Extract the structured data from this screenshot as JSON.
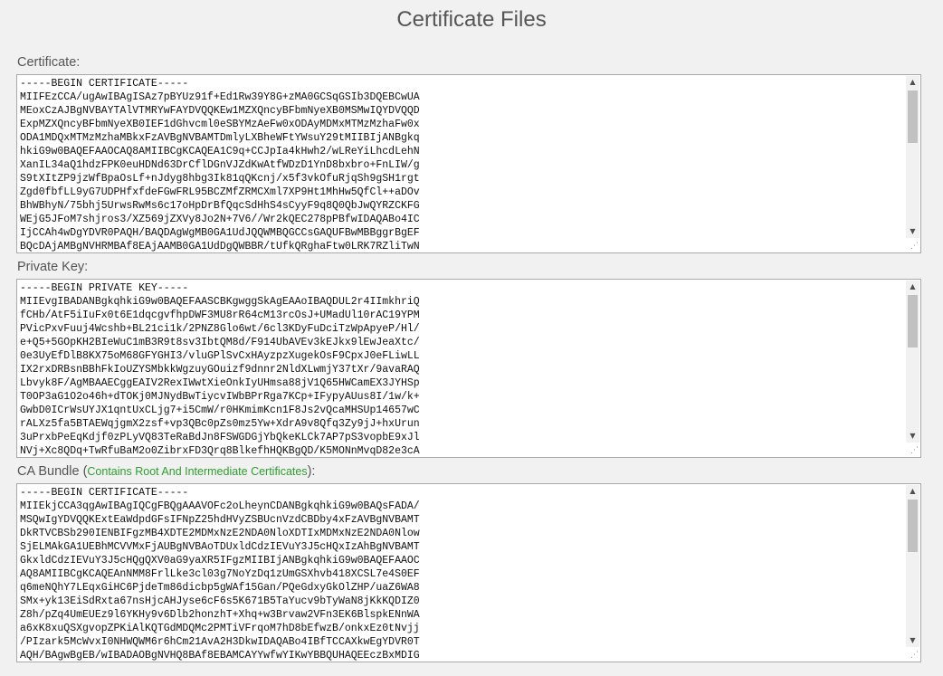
{
  "page": {
    "title": "Certificate Files"
  },
  "certificate": {
    "label": "Certificate:",
    "content": "-----BEGIN CERTIFICATE-----\nMIIFEzCCA/ugAwIBAgISAz7pBYUz91f+Ed1Rw39Y8G+zMA0GCSqGSIb3DQEBCwUA\nMEoxCzAJBgNVBAYTAlVTMRYwFAYDVQQKEw1MZXQncyBFbmNyeXB0MSMwIQYDVQQD\nExpMZXQncyBFbmNyeXB0IEF1dGhvcml0eSBYMzAeFw0xODAyMDMxMTMzMzhaFw0x\nODA1MDQxMTMzMzhaMBkxFzAVBgNVBAMTDmlyLXBheWFtYWsuY29tMIIBIjANBgkq\nhkiG9w0BAQEFAAOCAQ8AMIIBCgKCAQEA1C9q+CCJpIa4kHwh2/wLReYiLhcdLehN\nXanIL34aQ1hdzFPK0euHDNd63DrCflDGnVJZdKwAtfWDzD1YnD8bxbro+FnLIW/g\nS9tXItZP9jzWfBpaOsLf+nJdyg8hbg3Ik81qQKcnj/x5f3vkOfuRjqSh9gSH1rgt\nZgd0fbfLL9yG7UDPHfxfdeFGwFRL95BCZMfZRMCXml7XP9Ht1MhHw5QfCl++aDOv\nBhWBhyN/75bhj5UrwsRwMs6c17oHpDrBfQqcSdHhS4sCyyF9q8Q0QbJwQYRZCKFG\nWEjG5JFoM7shjros3/XZ569jZXVy8Jo2N+7V6//Wr2kQEC278pPBfwIDAQABo4IC\nIjCCAh4wDgYDVR0PAQH/BAQDAgWgMB0GA1UdJQQWMBQGCCsGAQUFBwMBBggrBgEF\nBQcDAjAMBgNVHRMBAf8EAjAAMB0GA1UdDgQWBBR/tUfkQRghaFtw0LRK7RZliTwN"
  },
  "private_key": {
    "label": "Private Key:",
    "content": "-----BEGIN PRIVATE KEY-----\nMIIEvgIBADANBgkqhkiG9w0BAQEFAASCBKgwggSkAgEAAoIBAQDUL2r4IImkhriQ\nfCHb/AtF5iIuFx0t6E1dqcgvfhpDWF3MU8rR64cM13rcOsJ+UMadUl10rAC19YPM\nPVicPxvFuuj4Wcshb+BL21ci1k/2PNZ8Glo6wt/6cl3KDyFuDciTzWpApyeP/Hl/\ne+Q5+5GOpKH2BIeWuC1mB3R9t8sv3IbtQM8d/F914UbAVEv3kEJkx9lEwJeaXtc/\n0e3UyEfDlB8KX75oM68GFYGHI3/vluGPlSvCxHAyzpzXugekOsF9CpxJ0eFLiwLL\nIX2rxDRBsnBBhFkIoUZYSMbkkWgzuyGOuizf9dnnr2NldXLwmjY37tXr/9avaRAQ\nLbvyk8F/AgMBAAECggEAIV2RexIWwtXieOnkIyUHmsa88jV1Q65HWCamEX3JYHSp\nT0OP3aG1O2o46h+dTOKj0MJNydBwTiycvIWbBPrRga7KCp+IFypyAUus8I/1w/k+\nGwbD0ICrWsUYJX1qntUxCLjg7+i5CmW/r0HKmimKcn1F8Js2vQcaMHSUp14657wC\nrALXz5fa5BTAEWqjgmX2zsf+vp3QBc0pZs0mz5Yw+XdrA9v8Qfq3Zy9jJ+hxUrun\n3uPrxbPeEqKdjf0zPLyVQ83TeRaBdJn8FSWGDGjYbQkeKLCk7AP7pS3vopbE9xJl\nNVj+Xc8QDq+TwRfuBaM2o0ZibrxFD3Qrq8BlkefhHQKBgQD/K5MONnMvqD82e3cA"
  },
  "ca_bundle": {
    "label": "CA Bundle",
    "paren_open": "(",
    "hint": "Contains Root And Intermediate Certificates",
    "paren_close": "):",
    "content": "-----BEGIN CERTIFICATE-----\nMIIEkjCCA3qgAwIBAgIQCgFBQgAAAVOFc2oLheynCDANBgkqhkiG9w0BAQsFADA/\nMSQwIgYDVQQKExtEaWdpdGFsIFNpZ25hdHVyZSBUcnVzdCBDby4xFzAVBgNVBAMT\nDkRTVCBSb290IENBIFgzMB4XDTE2MDMxNzE2NDA0NloXDTIxMDMxNzE2NDA0Nlow\nSjELMAkGA1UEBhMCVVMxFjAUBgNVBAoTDUxldCdzIEVuY3J5cHQxIzAhBgNVBAMT\nGkxldCdzIEVuY3J5cHQgQXV0aG9yaXR5IFgzMIIBIjANBgkqhkiG9w0BAQEFAAOC\nAQ8AMIIBCgKCAQEAnNMM8FrlLke3cl03g7NoYzDq1zUmGSXhvb418XCSL7e4S0EF\nq6meNQhY7LEqxGiHC6PjdeTm86dicbp5gWAf15Gan/PQeGdxyGkOlZHP/uaZ6WA8\nSMx+yk13EiSdRxta67nsHjcAHJyse6cF6s5K671B5TaYucv9bTyWaN8jKkKQDIZ0\nZ8h/pZq4UmEUEz9l6YKHy9v6Dlb2honzhT+Xhq+w3Brvaw2VFn3EK6BlspkENnWA\na6xK8xuQSXgvopZPKiAlKQTGdMDQMc2PMTiVFrqoM7hD8bEfwzB/onkxEz0tNvjj\n/PIzark5McWvxI0NHWQWM6r6hCm21AvA2H3DkwIDAQABo4IBfTCCAXkwEgYDVR0T\nAQH/BAgwBgEB/wIBADAOBgNVHQ8BAf8EBAMCAYYwfwYIKwYBBQUHAQEEczBxMDIG"
  }
}
